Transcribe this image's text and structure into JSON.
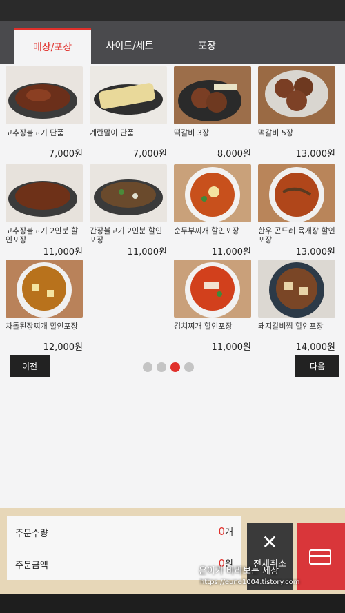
{
  "tabs": [
    {
      "label": "매장/포장"
    },
    {
      "label": "사이드/세트"
    },
    {
      "label": "포장"
    }
  ],
  "items": [
    {
      "name": "고추장불고기 단품",
      "price": "7,000원"
    },
    {
      "name": "계란말이 단품",
      "price": "7,000원"
    },
    {
      "name": "떡갈비 3장",
      "price": "8,000원"
    },
    {
      "name": "떡갈비 5장",
      "price": "13,000원"
    },
    {
      "name": "고추장불고기 2인분 할인포장",
      "price": "11,000원"
    },
    {
      "name": "간장불고기 2인분 할인포장",
      "price": "11,000원"
    },
    {
      "name": "순두부찌개 할인포장",
      "price": "11,000원"
    },
    {
      "name": "한우 곤드레 육개장 할인포장",
      "price": "13,000원"
    },
    {
      "name": "차돌된장찌개 할인포장",
      "price": "12,000원"
    },
    {
      "name": "김치찌개 할인포장",
      "price": "11,000원"
    },
    {
      "name": "돼지갈비찜 할인포장",
      "price": "14,000원"
    }
  ],
  "nav": {
    "prev": "이전",
    "next": "다음",
    "current_page": 3,
    "total_pages": 4
  },
  "summary": {
    "qty_label": "주문수량",
    "qty_value": "0",
    "qty_unit": "개",
    "amount_label": "주문금액",
    "amount_value": "0",
    "amount_unit": "원"
  },
  "actions": {
    "cancel_label": "전체취소"
  },
  "watermark": {
    "line1": "은이가 바라보는 세상",
    "line2": "https://eune1004.tistory.com"
  }
}
